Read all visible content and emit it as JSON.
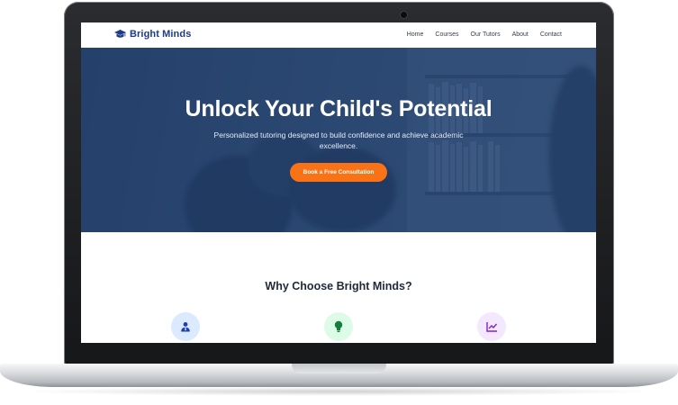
{
  "site": {
    "brand": "Bright Minds",
    "nav": [
      "Home",
      "Courses",
      "Our Tutors",
      "About",
      "Contact"
    ]
  },
  "hero": {
    "title": "Unlock Your Child's Potential",
    "subtitle": "Personalized tutoring designed to build confidence and achieve academic excellence.",
    "cta_label": "Book a Free Consultation"
  },
  "section": {
    "title": "Why Choose Bright Minds?"
  },
  "features": [
    {
      "icon": "tutor-icon",
      "bg": "#dbeafe",
      "color": "#1e40af"
    },
    {
      "icon": "lightbulb-icon",
      "bg": "#dcfce7",
      "color": "#15803d"
    },
    {
      "icon": "chart-line-icon",
      "bg": "#f3e8ff",
      "color": "#7e22ce"
    }
  ],
  "colors": {
    "brand": "#1e3a8a",
    "accent": "#f97316",
    "hero_overlay": "#1e3a6e"
  }
}
